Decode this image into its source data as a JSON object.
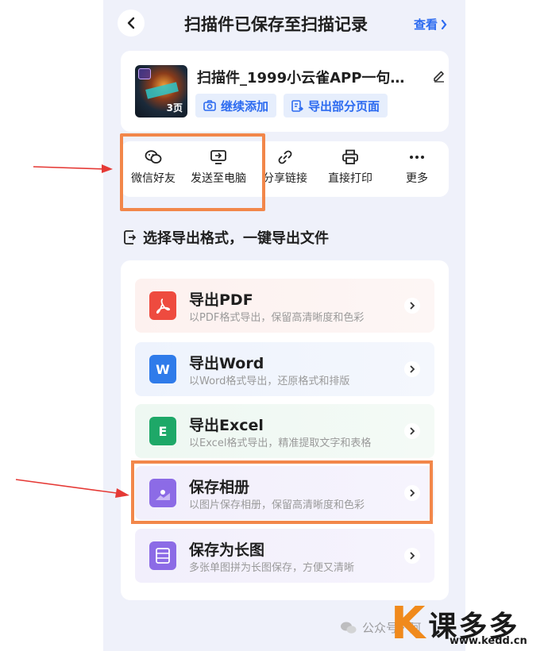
{
  "header": {
    "title": "扫描件已保存至扫描记录",
    "view_link": "查看"
  },
  "file": {
    "name": "扫描件_1999小云雀APP一句…",
    "page_count": "3页",
    "continue_add": "继续添加",
    "export_pages": "导出部分页面"
  },
  "share": {
    "items": [
      {
        "label": "微信好友",
        "icon": "wechat-icon"
      },
      {
        "label": "发送至电脑",
        "icon": "computer-send-icon"
      },
      {
        "label": "分享链接",
        "icon": "link-icon"
      },
      {
        "label": "直接打印",
        "icon": "printer-icon"
      },
      {
        "label": "更多",
        "icon": "more-icon"
      }
    ]
  },
  "section": {
    "title": "选择导出格式，一键导出文件"
  },
  "exports": [
    {
      "title": "导出PDF",
      "desc": "以PDF格式导出，保留高清晰度和色彩",
      "icon": "pdf-icon",
      "color": "#ee4b3f"
    },
    {
      "title": "导出Word",
      "desc": "以Word格式导出，还原格式和排版",
      "icon": "word-icon",
      "color": "#2f7bea"
    },
    {
      "title": "导出Excel",
      "desc": "以Excel格式导出，精准提取文字和表格",
      "icon": "excel-icon",
      "color": "#1ea868"
    },
    {
      "title": "保存相册",
      "desc": "以图片保存相册，保留高清晰度和色彩",
      "icon": "album-icon",
      "color": "#8c6be6"
    },
    {
      "title": "保存为长图",
      "desc": "多张单图拼为长图保存，方便又清晰",
      "icon": "long-image-icon",
      "color": "#8c6be6"
    }
  ],
  "watermark": {
    "public_account": "公众号 · 阿",
    "brand": "课多多",
    "url": "www.kedd.cn"
  },
  "colors": {
    "accent": "#2d6bf0",
    "highlight": "#f2874a",
    "arrow": "#e53935"
  }
}
